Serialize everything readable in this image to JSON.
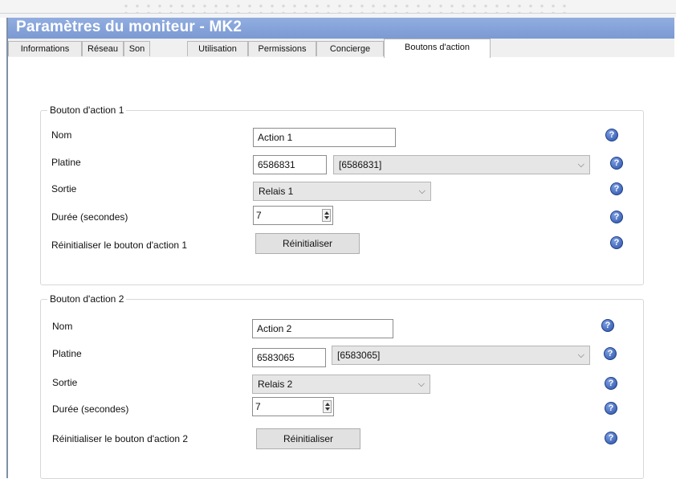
{
  "window": {
    "title": "Paramètres du moniteur - MK2"
  },
  "tabs": [
    {
      "label": "Informations"
    },
    {
      "label": "Réseau"
    },
    {
      "label": "Son"
    },
    {
      "label": "Utilisation"
    },
    {
      "label": "Permissions"
    },
    {
      "label": "Concierge"
    },
    {
      "label": "Boutons d'action",
      "active": true
    }
  ],
  "groups": [
    {
      "title": "Bouton  d'action 1",
      "name_label": "Nom",
      "name_value": "Action 1",
      "platine_label": "Platine",
      "platine_code": "6586831",
      "platine_select": "[6586831]",
      "sortie_label": "Sortie",
      "sortie_value": "Relais 1",
      "duree_label": "Durée (secondes)",
      "duree_value": "7",
      "reset_label": "Réinitialiser le bouton d'action 1",
      "reset_button": "Réinitialiser"
    },
    {
      "title": "Bouton d'action 2",
      "name_label": "Nom",
      "name_value": "Action 2",
      "platine_label": "Platine",
      "platine_code": "6583065",
      "platine_select": "[6583065]",
      "sortie_label": "Sortie",
      "sortie_value": "Relais 2",
      "duree_label": "Durée (secondes)",
      "duree_value": "7",
      "reset_label": "Réinitialiser le bouton d'action 2",
      "reset_button": "Réinitialiser"
    }
  ],
  "icons": {
    "help": "help-icon",
    "dropdown": "chevron-down-icon",
    "spinner": "spinner-arrows-icon",
    "help_glyph": "?",
    "chevron_glyph": "⌵"
  },
  "colors": {
    "titlebar": "#7b99d3",
    "help_icon": "#2a52a8",
    "combo_bg": "#e6e6e6"
  }
}
